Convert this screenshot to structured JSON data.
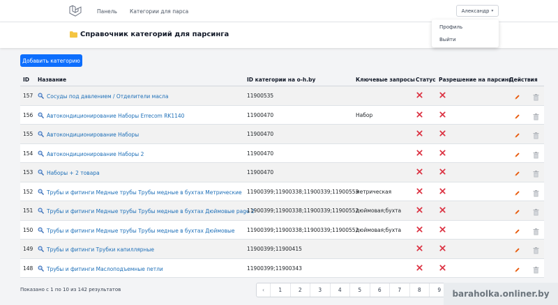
{
  "nav": {
    "links": [
      "Панель",
      "Категории для парса"
    ],
    "user_label": "Александр"
  },
  "dropdown": {
    "items": [
      "Профиль",
      "Выйти"
    ]
  },
  "header": {
    "title": "Справочник категорий для парсинга"
  },
  "toolbar": {
    "add_label": "Добавить категорию"
  },
  "table": {
    "columns": [
      "ID",
      "Название",
      "ID категории на o-h.by",
      "Ключевые запросы",
      "Статус",
      "Разрешение на парсинг",
      "Действия"
    ],
    "rows": [
      {
        "id": "157",
        "name": "Сосуды под давлением / Отделители масла",
        "oid": "11900535",
        "keywords": ""
      },
      {
        "id": "156",
        "name": "Автокондиционирование Наборы Errecom RK1140",
        "oid": "11900470",
        "keywords": "Набор"
      },
      {
        "id": "155",
        "name": "Автокондиционирование Наборы",
        "oid": "11900470",
        "keywords": ""
      },
      {
        "id": "154",
        "name": "Автокондиционирование Наборы 2",
        "oid": "11900470",
        "keywords": ""
      },
      {
        "id": "153",
        "name": "Наборы + 2 товара",
        "oid": "11900470",
        "keywords": ""
      },
      {
        "id": "152",
        "name": "Трубы и фитинги Медные трубы Трубы медные в бухтах Метрические",
        "oid": "11900399;11900338;11900339;11900553",
        "keywords": "метрическая"
      },
      {
        "id": "151",
        "name": "Трубы и фитинги Медные трубы Трубы медные в бухтах Дюймовые page 2",
        "oid": "11900399;11900338;11900339;11900552",
        "keywords": "дюймовая;бухта"
      },
      {
        "id": "150",
        "name": "Трубы и фитинги Медные трубы Трубы медные в бухтах Дюймовые",
        "oid": "11900399;11900338;11900339;11900552",
        "keywords": "дюймовая;бухта"
      },
      {
        "id": "149",
        "name": "Трубы и фитинги Трубки капиллярные",
        "oid": "11900399;11900415",
        "keywords": ""
      },
      {
        "id": "148",
        "name": "Трубы и фитинги Маслоподъемные петли",
        "oid": "11900399;11900343",
        "keywords": ""
      }
    ]
  },
  "footer": {
    "results_text": "Показано с 1 по 10 из 142 результатов",
    "prev_symbol": "‹",
    "pages": [
      "1",
      "2",
      "3",
      "4",
      "5",
      "6",
      "7",
      "8",
      "9"
    ]
  },
  "watermark": "baraholka.onliner.by",
  "colors": {
    "accent": "#0d6efd",
    "link": "#1d6fb8",
    "danger": "#dc3545",
    "edit": "#e8590c"
  },
  "icons": [
    "laravel-logo",
    "folder-icon",
    "magnifier-icon",
    "x-icon",
    "pencil-icon",
    "trash-icon",
    "chevron-down-icon"
  ]
}
